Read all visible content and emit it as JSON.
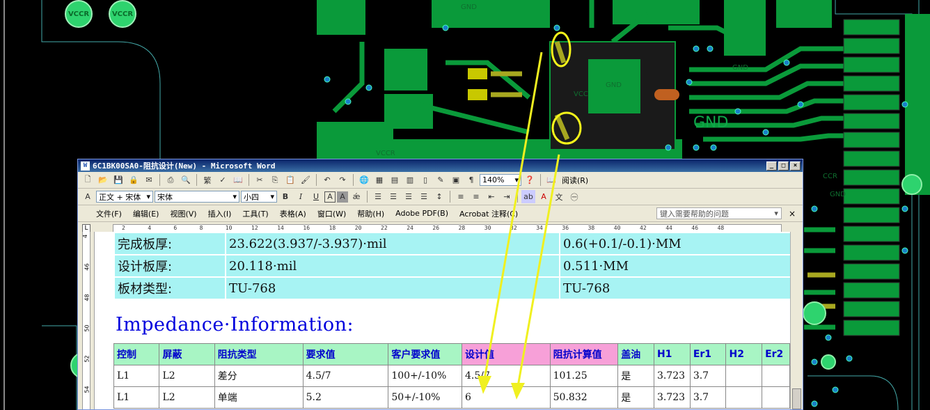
{
  "pcb": {
    "vccr_labels": [
      "VCCR",
      "VCCR"
    ],
    "gnd_label": "GND",
    "small_labels": [
      "GND",
      "GND",
      "GND",
      "VCC",
      "GND",
      "CCR",
      "VCCR"
    ]
  },
  "word": {
    "title": "6C1BK00SA0-阻抗设计(New) - Microsoft Word",
    "window_buttons": [
      "_",
      "□",
      "×"
    ],
    "toolbar1": {
      "zoom": "140%",
      "read_label": "阅读(R)",
      "buttons": [
        "new",
        "open",
        "save",
        "permission",
        "print",
        "print-preview",
        "spelling",
        "research",
        "cut",
        "copy",
        "paste",
        "format-painter",
        "undo",
        "redo",
        "hyperlink",
        "tables-borders",
        "insert-table",
        "insert-excel",
        "columns",
        "drawing",
        "document-map",
        "show-formatting",
        "help"
      ]
    },
    "toolbar2": {
      "style": "正文 + 宋体",
      "font": "宋体",
      "size": "小四",
      "bold": "B",
      "italic": "I",
      "underline": "U",
      "char_border": "A",
      "char_shading": "A"
    },
    "menu": {
      "items": [
        "文件(F)",
        "编辑(E)",
        "视图(V)",
        "插入(I)",
        "工具(T)",
        "表格(A)",
        "窗口(W)",
        "帮助(H)",
        "Adobe PDF(B)",
        "Acrobat 注释(C)"
      ],
      "help_placeholder": "键入需要帮助的问题",
      "close": "×"
    },
    "ruler": {
      "corner": "L",
      "marks": [
        "2",
        "4",
        "6",
        "8",
        "10",
        "12",
        "14",
        "16",
        "18",
        "20",
        "22",
        "24",
        "26",
        "28",
        "30",
        "32",
        "34",
        "36",
        "38",
        "40",
        "42",
        "44",
        "46",
        "48"
      ]
    },
    "vruler": {
      "marks": [
        "4",
        "46",
        "48",
        "50",
        "52",
        "54"
      ]
    },
    "info_rows": [
      {
        "label": "完成板厚:",
        "value1": "23.622(3.937/-3.937)·mil",
        "value2": "0.6(+0.1/-0.1)·MM"
      },
      {
        "label": "设计板厚:",
        "value1": "20.118·mil",
        "value2": "0.511·MM"
      },
      {
        "label": "板材类型:",
        "value1": "TU-768",
        "value2": "TU-768"
      }
    ],
    "heading": "Impedance·Information:",
    "impedance_table": {
      "headers": [
        "控制",
        "屏蔽",
        "阻抗类型",
        "要求值",
        "客户要求值",
        "设计值",
        "阻抗计算值",
        "盖油",
        "H1",
        "Er1",
        "H2",
        "Er2"
      ],
      "rows": [
        [
          "L1",
          "L2",
          "差分",
          "4.5/7",
          "100+/-10%",
          "4.5/7",
          "101.25",
          "是",
          "3.723",
          "3.7",
          "",
          ""
        ],
        [
          "L1",
          "L2",
          "单端",
          "5.2",
          "50+/-10%",
          "6",
          "50.832",
          "是",
          "3.723",
          "3.7",
          "",
          ""
        ]
      ]
    }
  }
}
